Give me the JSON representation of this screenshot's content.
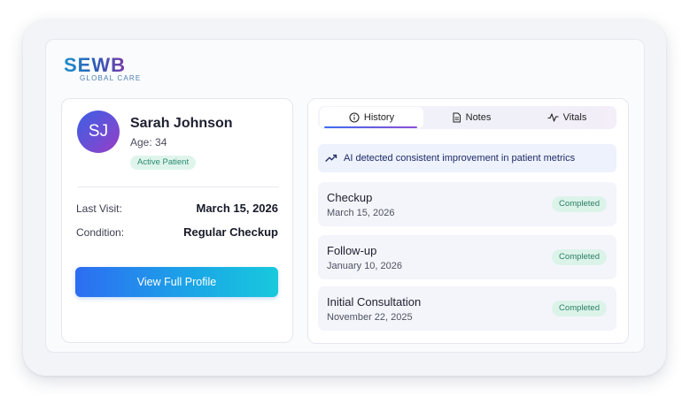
{
  "brand": {
    "name": "SEWB",
    "subtitle": "GLOBAL CARE"
  },
  "patient": {
    "initials": "SJ",
    "name": "Sarah Johnson",
    "age": "Age: 34",
    "status": "Active Patient",
    "fields": [
      {
        "label": "Last Visit:",
        "value": "March 15, 2026"
      },
      {
        "label": "Condition:",
        "value": "Regular Checkup"
      }
    ],
    "button": "View Full Profile"
  },
  "tabs": [
    {
      "label": "History",
      "icon": "info-icon",
      "active": true
    },
    {
      "label": "Notes",
      "icon": "document-icon",
      "active": false
    },
    {
      "label": "Vitals",
      "icon": "pulse-icon",
      "active": false
    }
  ],
  "insight": {
    "icon": "trending-up-icon",
    "text": "AI detected consistent improvement in patient metrics"
  },
  "history": [
    {
      "title": "Checkup",
      "date": "March 15, 2026",
      "status": "Completed"
    },
    {
      "title": "Follow-up",
      "date": "January 10, 2026",
      "status": "Completed"
    },
    {
      "title": "Initial Consultation",
      "date": "November 22, 2025",
      "status": "Completed"
    }
  ],
  "colors": {
    "accent": "#2d6df2",
    "accent_end": "#18c9dc",
    "success": "#2a8a6f",
    "success_bg": "#dff5ec"
  }
}
